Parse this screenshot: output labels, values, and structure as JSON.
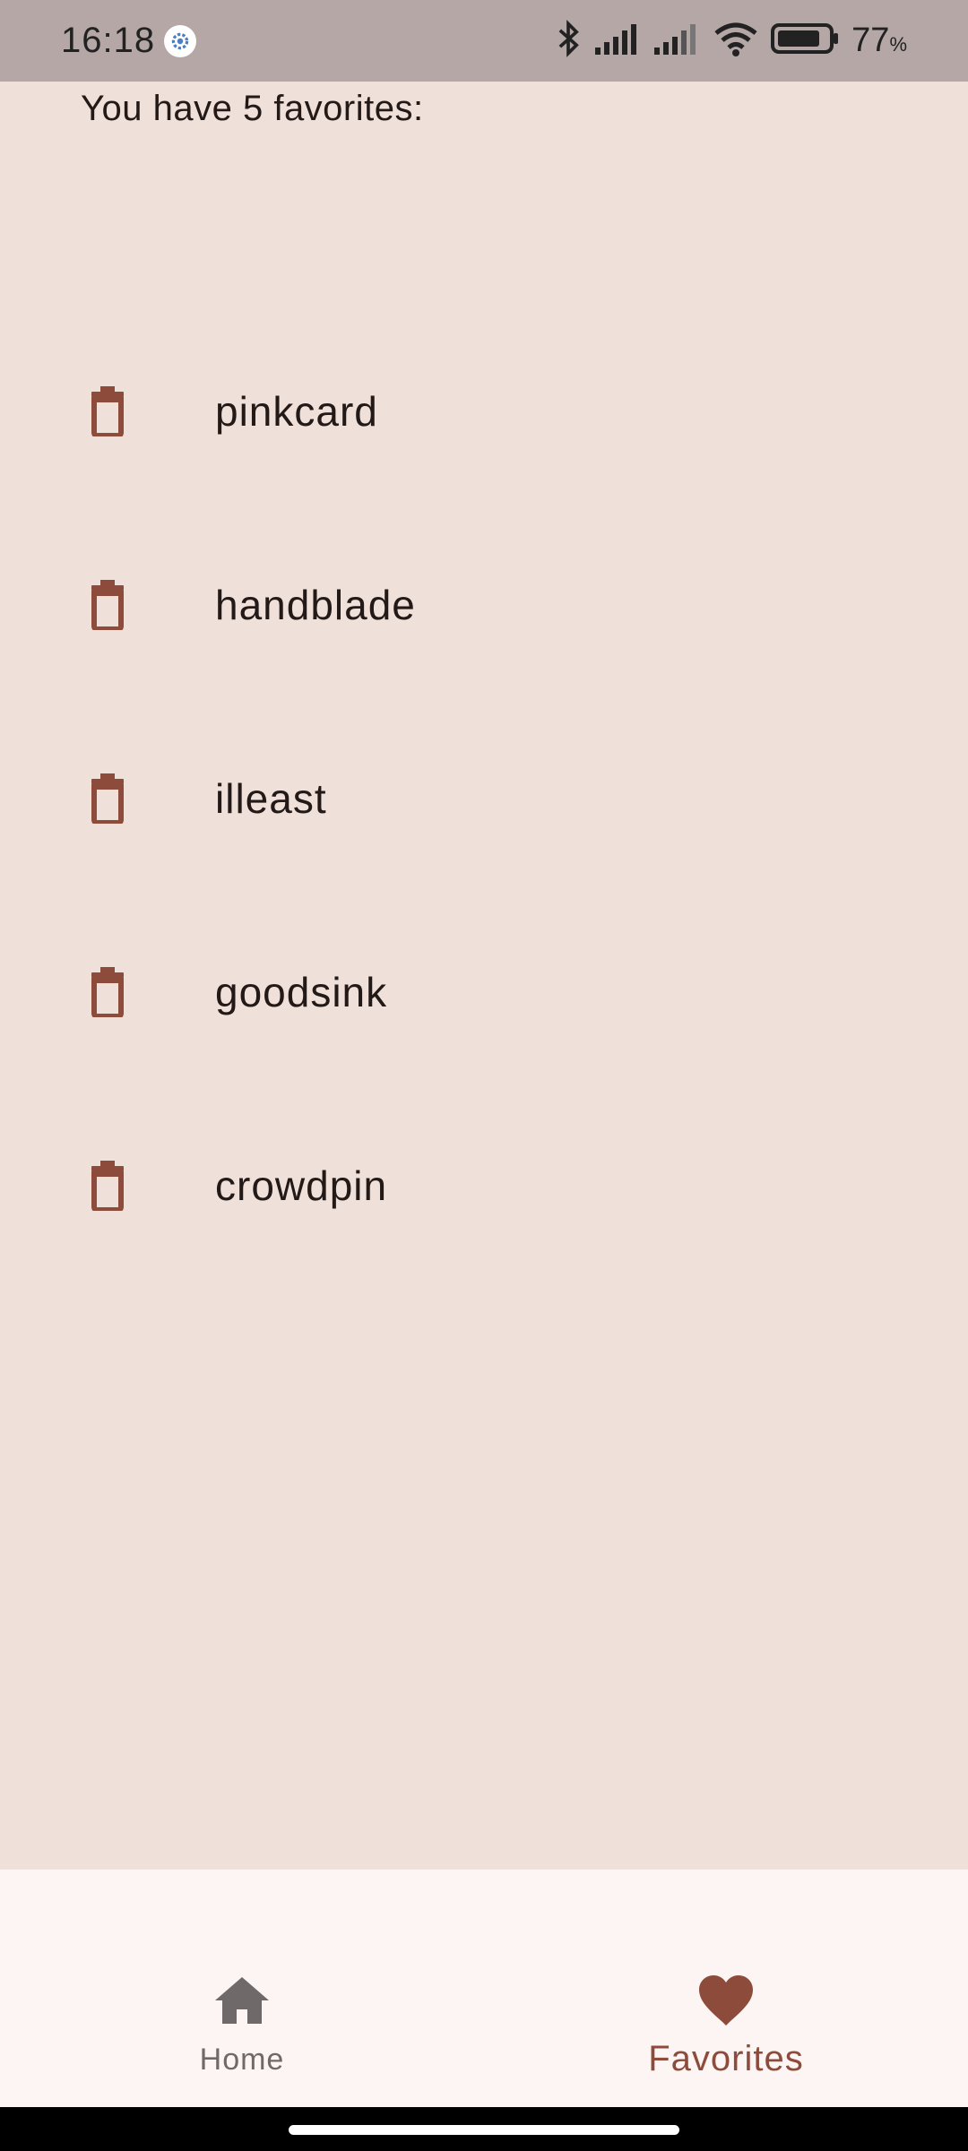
{
  "status_bar": {
    "time": "16:18",
    "battery_percent": "77",
    "battery_unit": "%",
    "icons": [
      "settings-icon",
      "bluetooth-icon",
      "signal-icon",
      "signal-icon",
      "wifi-icon",
      "battery-icon"
    ]
  },
  "favorites": {
    "count_text": "You have 5 favorites:",
    "items": [
      {
        "name": "pinkcard",
        "icon": "delete-icon"
      },
      {
        "name": "handblade",
        "icon": "delete-icon"
      },
      {
        "name": "illeast",
        "icon": "delete-icon"
      },
      {
        "name": "goodsink",
        "icon": "delete-icon"
      },
      {
        "name": "crowdpin",
        "icon": "delete-icon"
      }
    ]
  },
  "bottom_nav": {
    "home_label": "Home",
    "home_icon": "home-icon",
    "favorites_label": "Favorites",
    "favorites_icon": "heart-icon",
    "selected": "Favorites"
  },
  "colors": {
    "background": "#efe0da",
    "status_bar": "#b4a7a6",
    "accent": "#8d4c3b",
    "nav_background": "#fdf5f3"
  }
}
